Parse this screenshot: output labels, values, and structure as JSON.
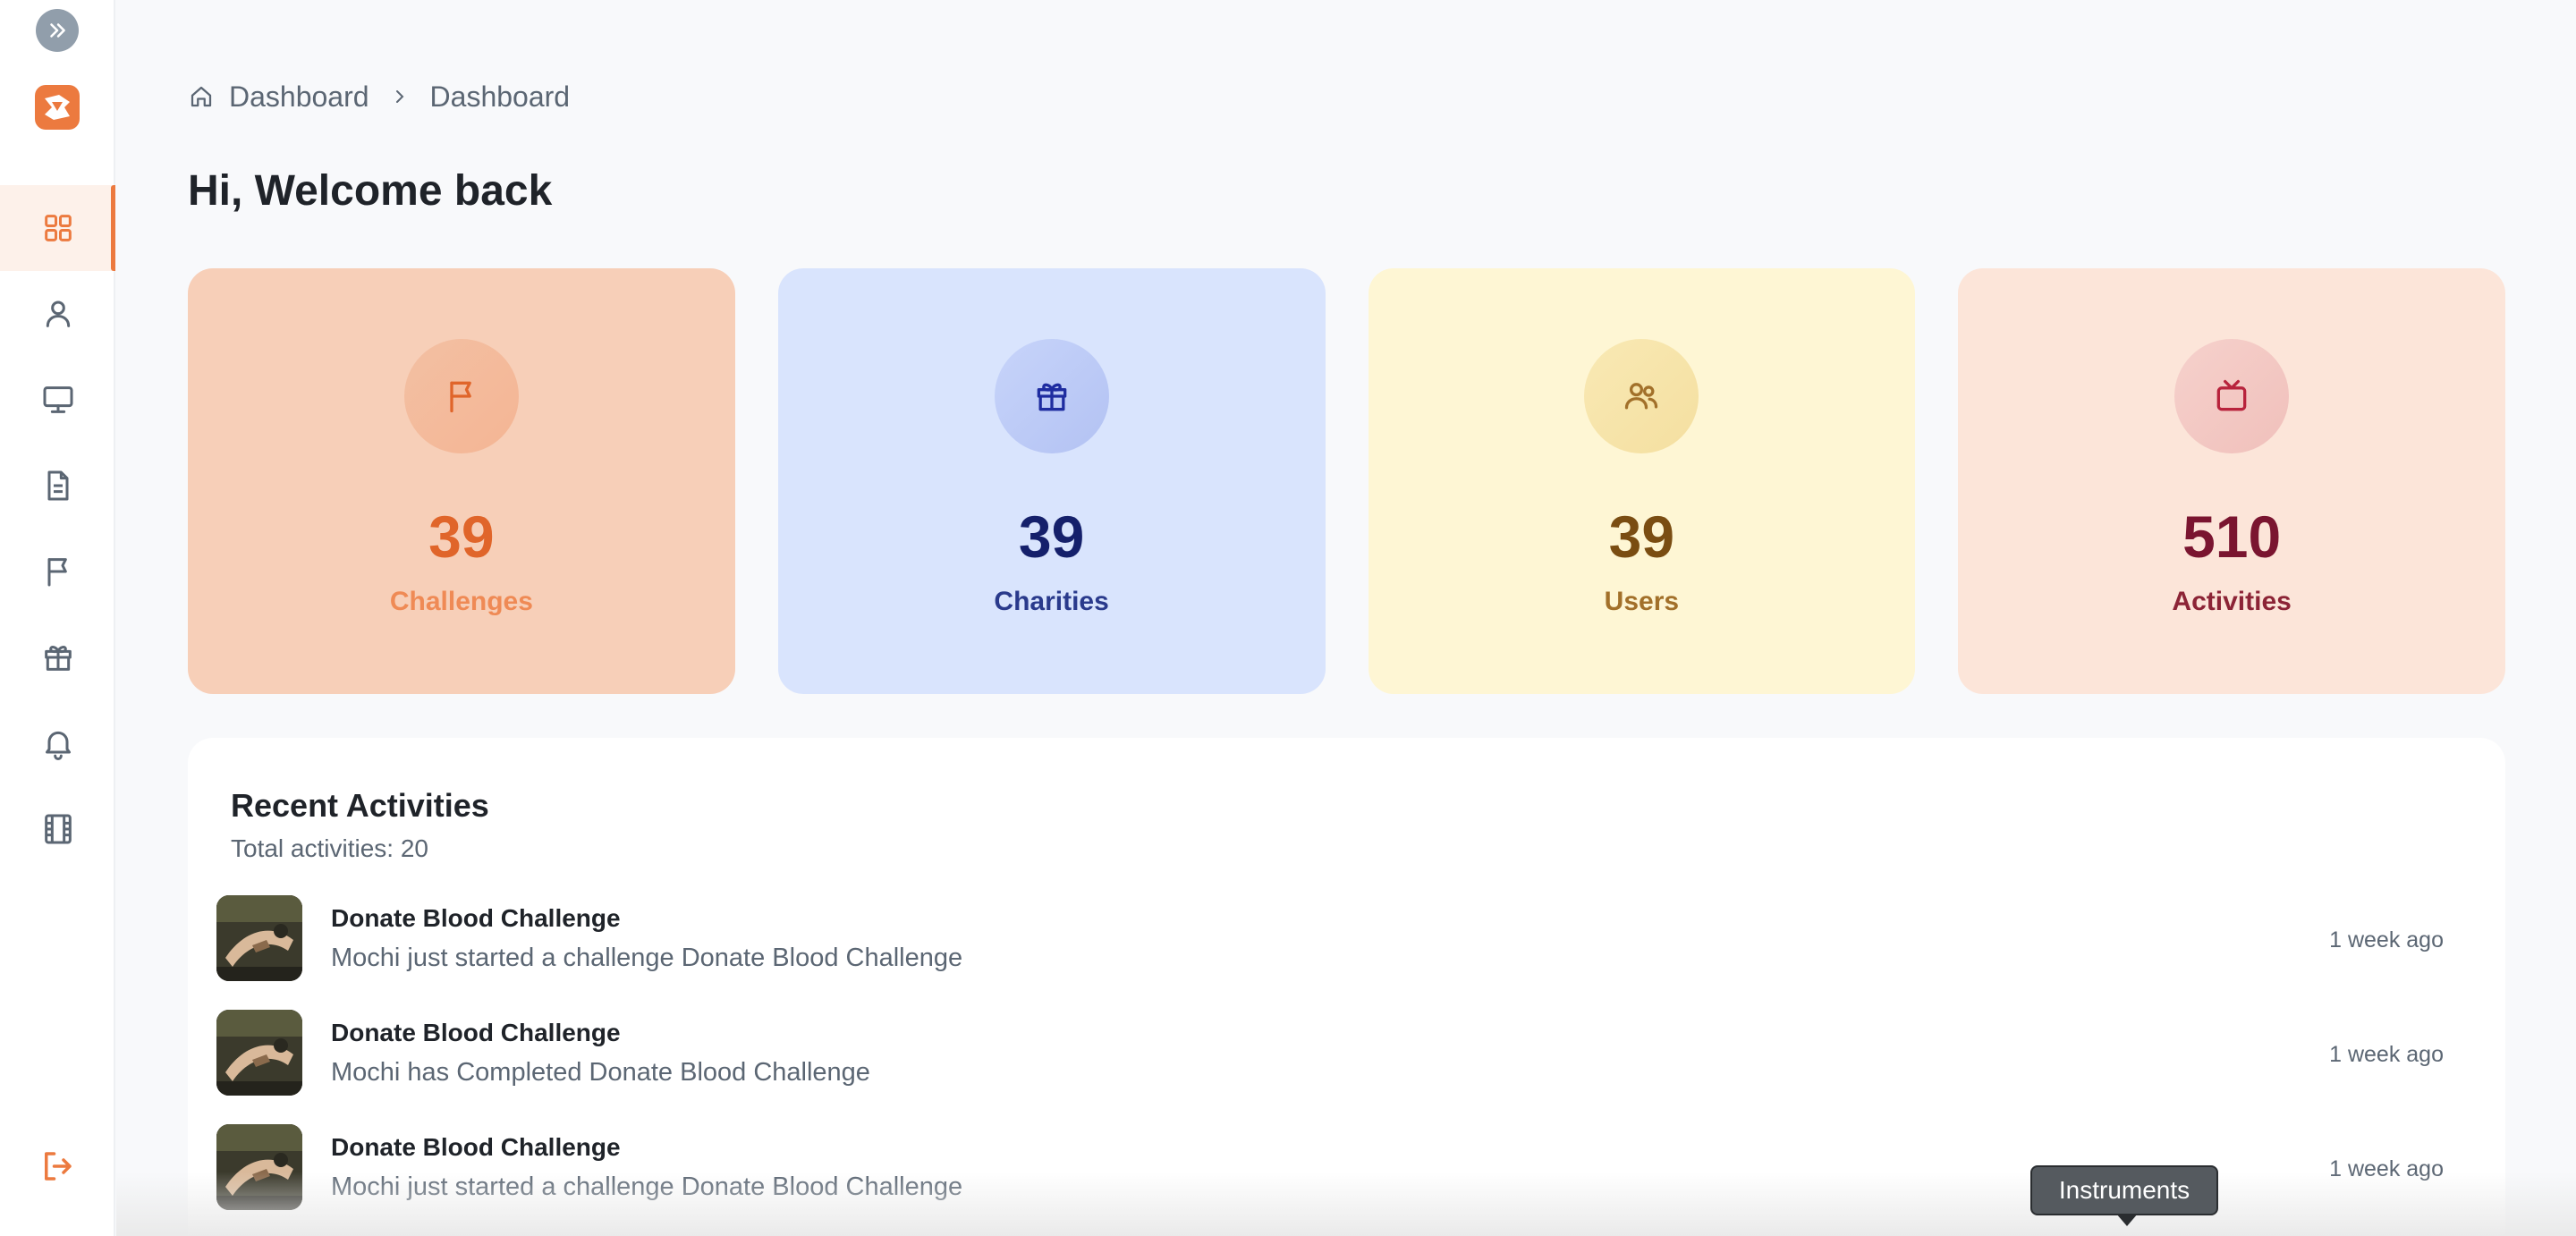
{
  "breadcrumb": {
    "items": [
      "Dashboard",
      "Dashboard"
    ]
  },
  "page": {
    "title": "Hi, Welcome back"
  },
  "sidebar": {
    "items": [
      {
        "icon": "dashboard-grid-icon",
        "active": true
      },
      {
        "icon": "user-icon",
        "active": false
      },
      {
        "icon": "monitor-icon",
        "active": false
      },
      {
        "icon": "document-icon",
        "active": false
      },
      {
        "icon": "flag-icon",
        "active": false
      },
      {
        "icon": "gift-icon",
        "active": false
      },
      {
        "icon": "bell-icon",
        "active": false
      },
      {
        "icon": "film-icon",
        "active": false
      }
    ],
    "logout_icon": "logout-icon",
    "accent": "#ec7a3f"
  },
  "stats": [
    {
      "value": "39",
      "label": "Challenges",
      "icon": "flag-icon",
      "color": "#e0652a"
    },
    {
      "value": "39",
      "label": "Charities",
      "icon": "gift-icon",
      "color": "#15206b"
    },
    {
      "value": "39",
      "label": "Users",
      "icon": "users-icon",
      "color": "#7a4d12"
    },
    {
      "value": "510",
      "label": "Activities",
      "icon": "tv-icon",
      "color": "#7a1530"
    }
  ],
  "recent_activities": {
    "title": "Recent Activities",
    "subtitle": "Total activities: 20",
    "items": [
      {
        "title": "Donate Blood Challenge",
        "description": "Mochi just started a challenge Donate Blood Challenge",
        "time": "1 week ago"
      },
      {
        "title": "Donate Blood Challenge",
        "description": "Mochi has Completed Donate Blood Challenge",
        "time": "1 week ago"
      },
      {
        "title": "Donate Blood Challenge",
        "description": "Mochi just started a challenge Donate Blood Challenge",
        "time": "1 week ago"
      }
    ]
  },
  "tooltip": {
    "text": "Instruments"
  }
}
